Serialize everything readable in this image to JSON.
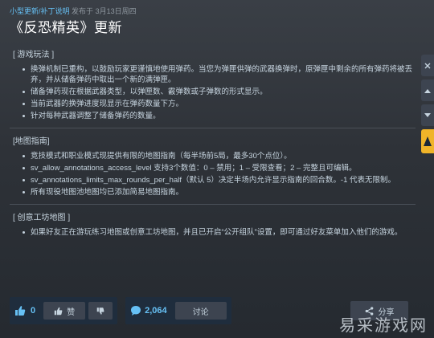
{
  "header": {
    "author": "小型更新/补丁说明",
    "published_label": "发布于",
    "date": "3月13日周四",
    "title": "《反恐精英》更新"
  },
  "sections": [
    {
      "heading": "[ 游戏玩法 ]",
      "items": [
        "换弹机制已重构，以鼓励玩家更谨慎地使用弹药。当您为弹匣供弹的武器换弹时，原弹匣中剩余的所有弹药将被丢弃，并从储备弹药中取出一个新的满弹匣。",
        "储备弹药现在根据武器类型，以弹匣数、霰弹数或子弹数的形式显示。",
        "当前武器的换弹进度现显示在弹药数量下方。",
        "针对每种武器调整了储备弹药的数量。"
      ]
    },
    {
      "heading": "[地图指南]",
      "items": [
        "竞技模式和职业模式现提供有限的地图指南（每半场前5局，最多30个点位）。",
        "sv_allow_annotations_access_level 支持3个数值：0 – 禁用；1 – 受限查看；2 – 完整且可编辑。",
        "sv_annotations_limits_max_rounds_per_half（默认 5）决定半场内允许显示指南的回合数。-1 代表无限制。",
        "所有现役地图池地图均已添加简易地图指南。"
      ]
    },
    {
      "heading": "[ 创意工坊地图 ]",
      "items": [
        "如果好友正在游玩练习地图或创意工坊地图，并且已开启“公开组队”设置，即可通过好友菜单加入他们的游戏。"
      ]
    }
  ],
  "side_tools": [
    "close-icon",
    "up-icon",
    "down-icon",
    "highlight-icon"
  ],
  "footer": {
    "like_count": "0",
    "like_label": "赞",
    "comment_count": "2,064",
    "discuss_label": "讨论",
    "share_label": "分享"
  },
  "watermark": "易采游戏网",
  "colors": {
    "accent": "#66c0f4",
    "background": "#2e3238",
    "highlight": "#f0b429"
  }
}
